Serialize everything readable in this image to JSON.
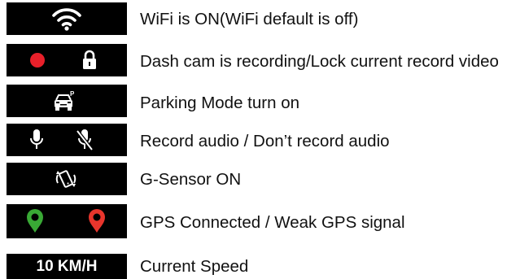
{
  "legend": {
    "items": [
      {
        "icons": [
          "wifi-icon"
        ],
        "description": "WiFi is ON(WiFi default is off)"
      },
      {
        "icons": [
          "recording-dot-icon",
          "lock-icon"
        ],
        "description": "Dash cam is recording/Lock current record video"
      },
      {
        "icons": [
          "parking-car-icon"
        ],
        "description": "Parking Mode turn on"
      },
      {
        "icons": [
          "microphone-icon",
          "microphone-muted-icon"
        ],
        "description": "Record audio / Don’t record audio"
      },
      {
        "icons": [
          "g-sensor-phone-icon"
        ],
        "description": "G-Sensor ON"
      },
      {
        "icons": [
          "gps-connected-pin-icon",
          "gps-weak-pin-icon"
        ],
        "description": "GPS Connected / Weak GPS signal"
      },
      {
        "icons": [],
        "badge_text": "10 KM/H",
        "description": "Current Speed"
      }
    ]
  },
  "colors": {
    "icon_background": "#000000",
    "icon_foreground": "#ffffff",
    "recording_red": "#e8202a",
    "gps_green": "#39a935",
    "gps_red": "#e8352c",
    "text": "#111111"
  }
}
